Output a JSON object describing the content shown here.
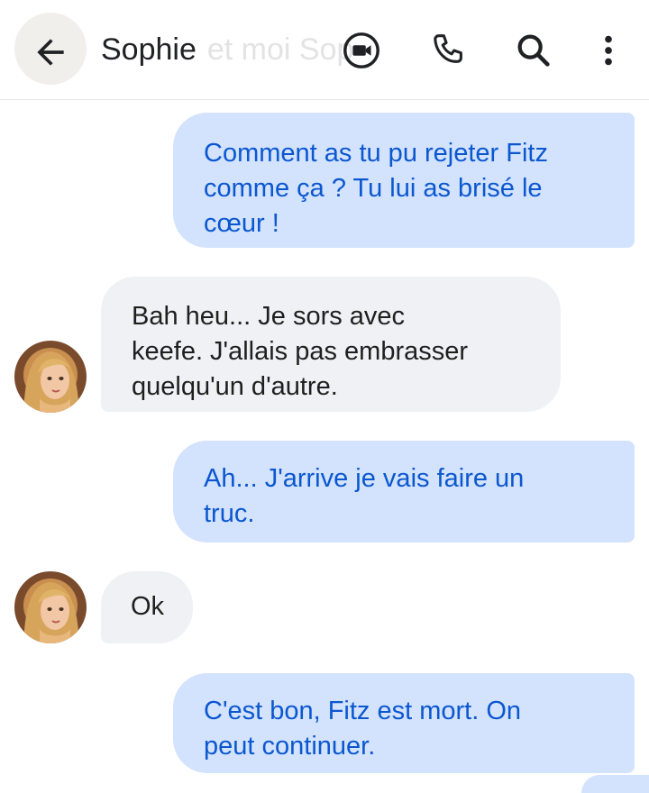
{
  "header": {
    "contact_name": "Sophie",
    "faded_subtitle": "et moi Sop",
    "icons": {
      "back": "arrow-left-icon",
      "video": "video-call-icon",
      "phone": "phone-icon",
      "search": "search-icon",
      "more": "more-vert-icon"
    }
  },
  "theme": {
    "outgoing_bg": "#d3e3fd",
    "outgoing_text": "#0b57d0",
    "incoming_bg": "#f0f1f4",
    "incoming_text": "#1f1f1f"
  },
  "messages": [
    {
      "direction": "outgoing",
      "lines": [
        "Comment as tu pu rejeter Fitz",
        "comme ça ? Tu lui as brisé le",
        "cœur !"
      ]
    },
    {
      "direction": "incoming",
      "lines": [
        "Bah heu... Je sors avec",
        "keefe. J'allais pas embrasser",
        "quelqu'un d'autre."
      ]
    },
    {
      "direction": "outgoing",
      "lines": [
        "Ah... J'arrive je vais faire un",
        "truc."
      ]
    },
    {
      "direction": "incoming",
      "lines": [
        "Ok"
      ]
    },
    {
      "direction": "outgoing",
      "lines": [
        "C'est bon, Fitz est mort. On",
        "peut continuer."
      ]
    }
  ]
}
